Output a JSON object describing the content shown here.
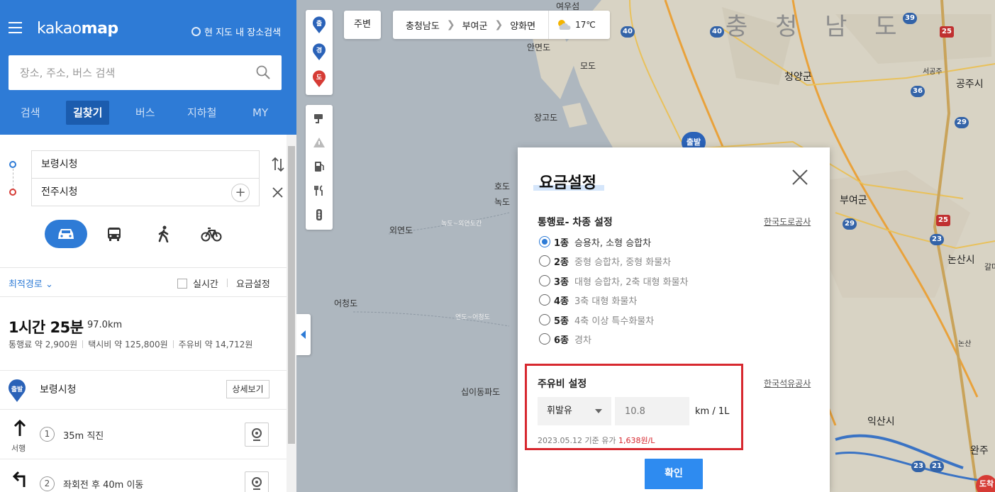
{
  "header": {
    "logo_pre": "kakao",
    "logo_bold": "map",
    "map_search_toggle": "현 지도 내 장소검색",
    "search_placeholder": "장소, 주소, 버스 검색",
    "tabs": [
      {
        "label": "검색"
      },
      {
        "label": "길찾기",
        "active": true
      },
      {
        "label": "버스"
      },
      {
        "label": "지하철"
      },
      {
        "label": "MY"
      }
    ]
  },
  "route": {
    "origin": "보령시청",
    "destination": "전주시청",
    "modes": [
      "car-icon",
      "bus-icon",
      "walk-icon",
      "bike-icon"
    ],
    "option": "최적경로",
    "realtime_label": "실시간",
    "fee_settings_label": "요금설정",
    "duration": "1시간 25분",
    "distance": "97.0km",
    "costs": [
      "통행료 약 2,900원",
      "택시비 약 125,800원",
      "주유비 약 14,712원"
    ],
    "start_badge": "출발",
    "start_name": "보령시청",
    "detail_button": "상세보기",
    "steps": [
      {
        "num": "1",
        "text": "35m 직진",
        "dir_label": "서행"
      },
      {
        "num": "2",
        "text": "좌회전 후 40m 이동"
      }
    ]
  },
  "map": {
    "pins": [
      "출",
      "경",
      "도"
    ],
    "nearby": "주변",
    "breadcrumb": [
      "충청남도",
      "부여군",
      "양화면"
    ],
    "temperature": "17℃",
    "region_title": "충 청 남 도",
    "labels": {
      "yeouiseom": "여우섬",
      "anmyeondo": "안면도",
      "modo": "모도",
      "janggodo": "장고도",
      "hodo": "호도",
      "nokdo": "녹도",
      "oeyeondo": "외연도",
      "nokdo_route": "녹도~외연도간",
      "eocheongdo": "어청도",
      "eocheong_route": "연도~어청도",
      "sipidongpado": "십이동파도",
      "cheongyang": "청양군",
      "buyeo": "부여군",
      "gongju": "공주시",
      "nonsan": "논산시",
      "iksan": "익산시",
      "wanju": "완주",
      "seogongju": "서공주",
      "nonsan_ic": "논산",
      "galma": "갈마"
    },
    "route_shields": [
      "39",
      "25",
      "40",
      "36",
      "40",
      "29",
      "25",
      "23",
      "23",
      "21"
    ],
    "start_pin": "출발",
    "end_pin": "도착"
  },
  "modal": {
    "title": "요금설정",
    "toll_section": "통행료- 차종 설정",
    "toll_link": "한국도로공사",
    "vehicle_classes": [
      {
        "cls": "1종",
        "desc": "승용차, 소형 승합차",
        "checked": true
      },
      {
        "cls": "2종",
        "desc": "중형 승합차, 중형 화물차"
      },
      {
        "cls": "3종",
        "desc": "대형 승합차, 2축 대형 화물차"
      },
      {
        "cls": "4종",
        "desc": "3축 대형 화물차"
      },
      {
        "cls": "5종",
        "desc": "4축 이상 특수화물차"
      },
      {
        "cls": "6종",
        "desc": "경차"
      }
    ],
    "fuel_section": "주유비 설정",
    "fuel_link": "한국석유공사",
    "fuel_type": "휘발유",
    "fuel_efficiency_placeholder": "10.8",
    "fuel_unit": "km / 1L",
    "price_note_prefix": "2023.05.12 기준 유가",
    "price_value": "1,638원/L",
    "confirm": "확인"
  },
  "colors": {
    "brand_blue": "#2e7bd6",
    "highlight_red": "#d7282f",
    "confirm_blue": "#2e8bf0"
  }
}
